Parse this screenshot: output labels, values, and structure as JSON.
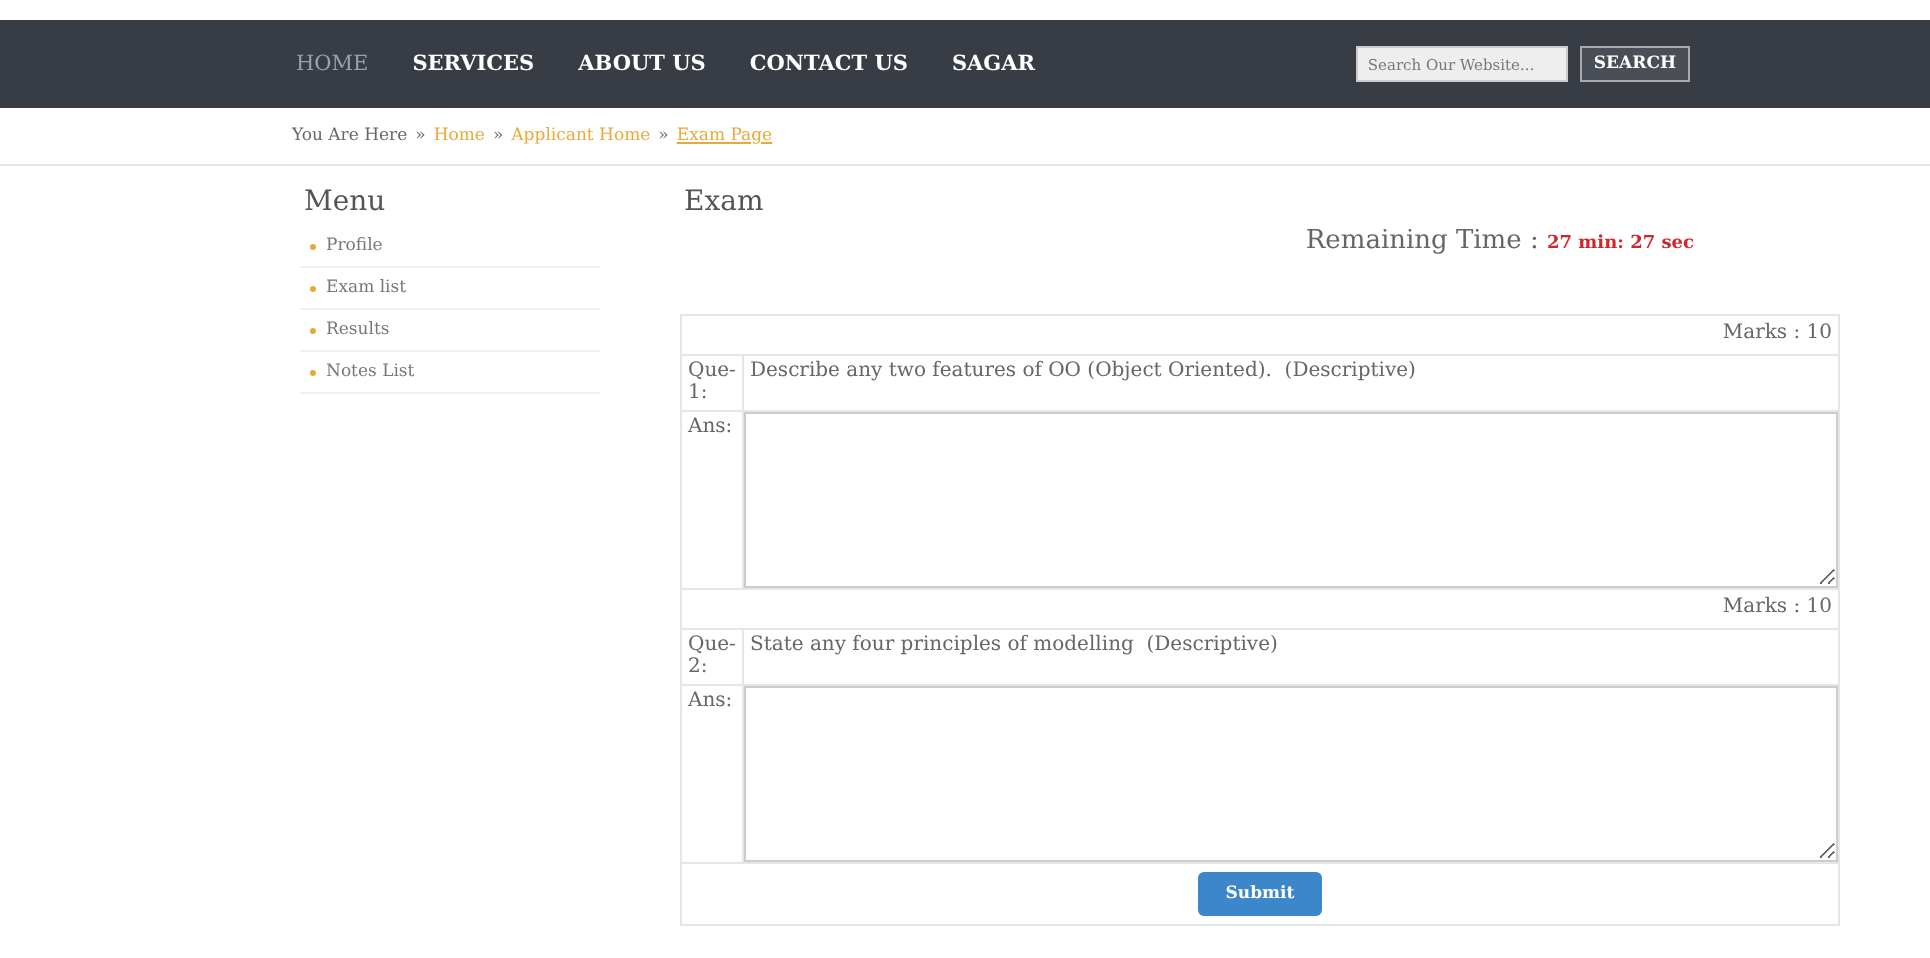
{
  "nav": {
    "items": [
      {
        "label": "HOME",
        "selected": true
      },
      {
        "label": "SERVICES",
        "selected": false
      },
      {
        "label": "ABOUT US",
        "selected": false
      },
      {
        "label": "CONTACT US",
        "selected": false
      },
      {
        "label": "SAGAR",
        "selected": false
      }
    ],
    "search": {
      "placeholder": "Search Our Website..."
    },
    "search_button": "SEARCH"
  },
  "breadcrumb": {
    "prefix": "You Are Here",
    "separator": "»",
    "links": [
      {
        "label": "Home",
        "current": false
      },
      {
        "label": "Applicant Home",
        "current": false
      },
      {
        "label": "Exam Page",
        "current": true
      }
    ]
  },
  "sidebar": {
    "title": "Menu",
    "items": [
      "Profile",
      "Exam list",
      "Results",
      "Notes List"
    ]
  },
  "exam": {
    "title": "Exam",
    "timer_label": "Remaining Time :",
    "timer_value": "27 min: 27 sec",
    "questions": [
      {
        "marks": "Marks : 10",
        "number": "Que-1:",
        "text": "Describe any two features of OO (Object Oriented).  (Descriptive)",
        "answer_label": "Ans:"
      },
      {
        "marks": "Marks : 10",
        "number": "Que-2:",
        "text": "State any four principles of modelling  (Descriptive)",
        "answer_label": "Ans:"
      }
    ],
    "submit": "Submit"
  }
}
